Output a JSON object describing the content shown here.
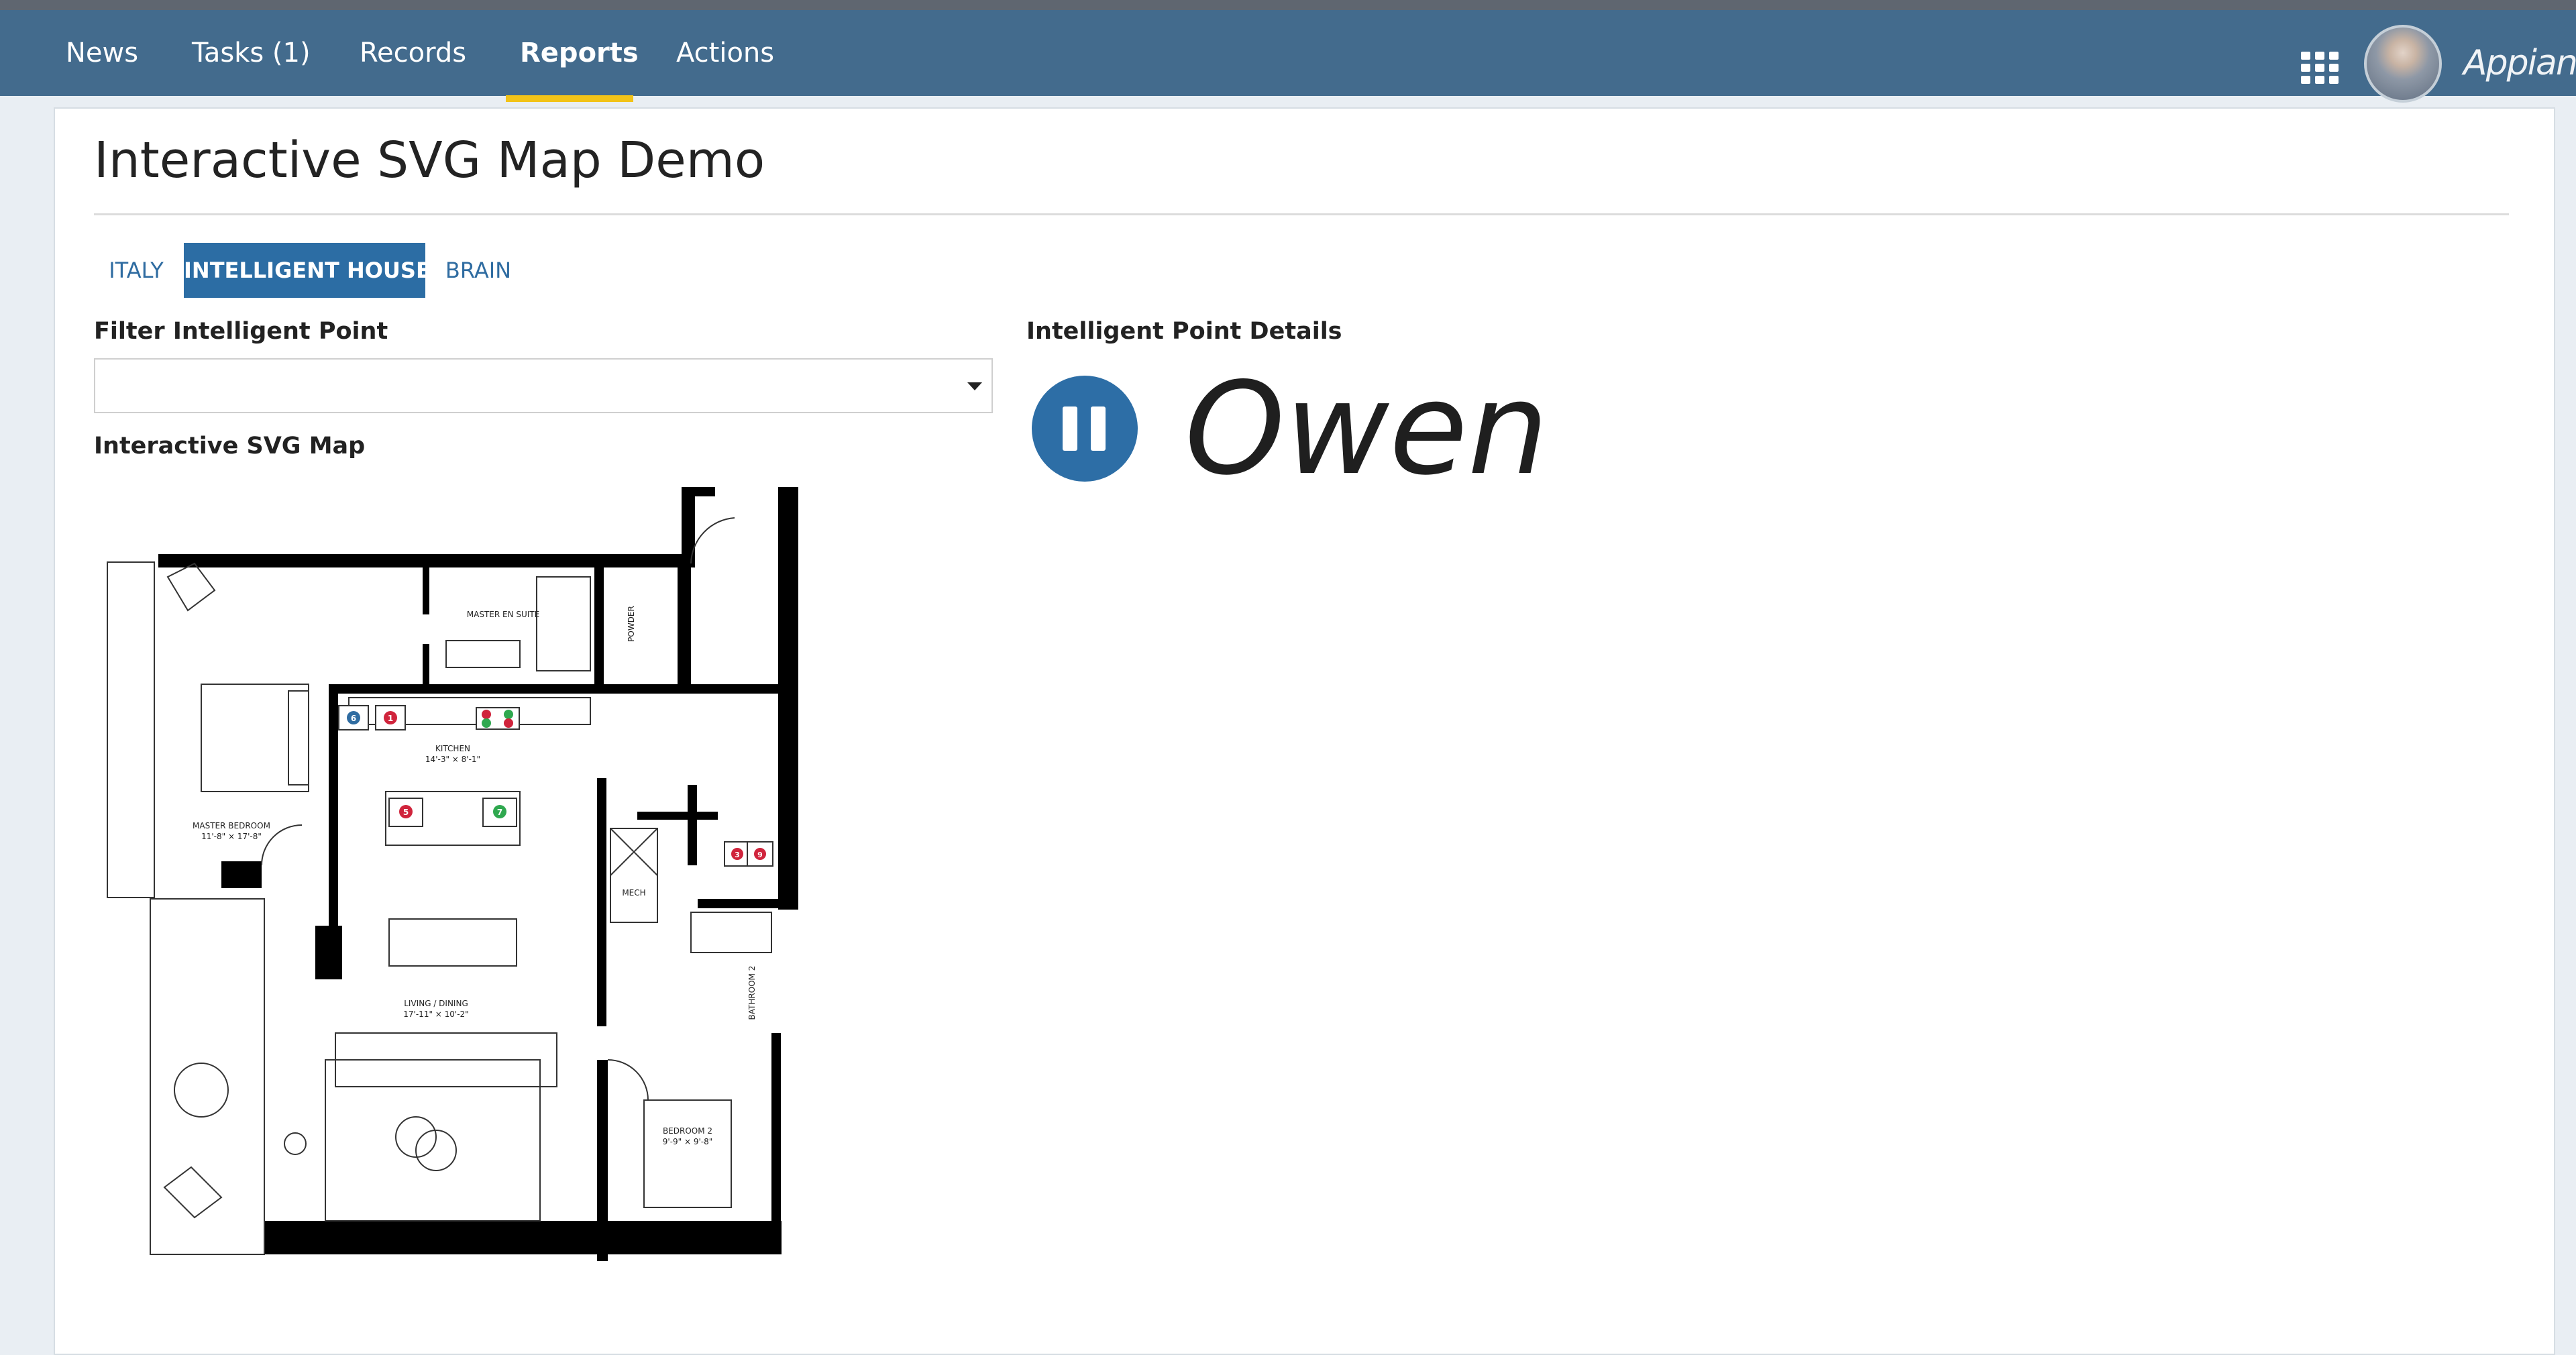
{
  "nav": {
    "items": [
      {
        "label": "News",
        "active": false
      },
      {
        "label": "Tasks (1)",
        "active": false
      },
      {
        "label": "Records",
        "active": false
      },
      {
        "label": "Reports",
        "active": true
      },
      {
        "label": "Actions",
        "active": false
      }
    ],
    "apps_icon": "grid-icon",
    "logo": "Appian",
    "accent_color": "#f2c318",
    "bar_color": "#436b8d"
  },
  "page": {
    "title": "Interactive SVG Map Demo",
    "tabs": [
      {
        "label": "ITALY",
        "active": false
      },
      {
        "label": "INTELLIGENT HOUSE",
        "active": true
      },
      {
        "label": "BRAIN",
        "active": false
      }
    ]
  },
  "filter": {
    "label": "Filter Intelligent Point",
    "value": ""
  },
  "map": {
    "label": "Interactive SVG Map",
    "room_labels": {
      "master_ensuite": "MASTER EN SUITE",
      "powder": "POWDER",
      "kitchen": "KITCHEN",
      "kitchen_dims": "14'-3\" × 8'-1\"",
      "master_bedroom": "MASTER BEDROOM",
      "master_bedroom_dims": "11'-8\" × 17'-8\"",
      "mech": "MECH",
      "living_dining": "LIVING / DINING",
      "living_dining_dims": "17'-11\" × 10'-2\"",
      "bathroom2": "BATHROOM 2",
      "bedroom2": "BEDROOM 2",
      "bedroom2_dims": "9'-9\" × 9'-8\""
    },
    "points": [
      {
        "id": "6",
        "color": "#2f6ca1"
      },
      {
        "id": "1",
        "color": "#d0243c"
      },
      {
        "id": "5",
        "color": "#d0243c"
      },
      {
        "id": "7",
        "color": "#2fa84f"
      },
      {
        "id": "3",
        "color": "#d0243c"
      },
      {
        "id": "9",
        "color": "#d0243c"
      }
    ]
  },
  "details": {
    "label": "Intelligent Point Details",
    "name": "Owen",
    "control_icon": "pause-icon"
  }
}
